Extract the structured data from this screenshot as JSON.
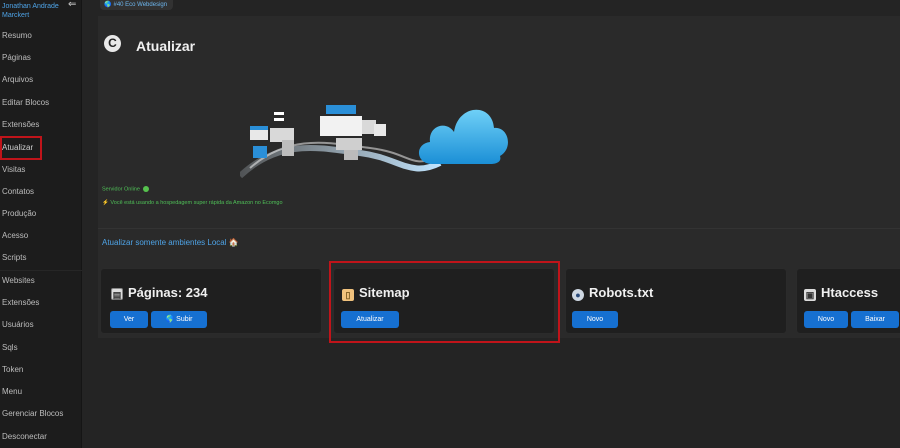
{
  "sidebar": {
    "user_name": "Jonathan Andrade Marckert",
    "items": [
      "Resumo",
      "Páginas",
      "Arquivos",
      "Editar Blocos",
      "Extensões",
      "Atualizar",
      "Visitas",
      "Contatos",
      "Produção",
      "Acesso",
      "Scripts",
      "Websites",
      "Extensões",
      "Usuários",
      "Sqls",
      "Token",
      "Menu",
      "Gerenciar Blocos",
      "Desconectar"
    ],
    "active_item": "Atualizar"
  },
  "header": {
    "badge": "#40 Eco Webdesign",
    "badge_icon": "globe-icon"
  },
  "hero": {
    "title": "Atualizar",
    "status": "Servidor Online",
    "notice": "Você está usando a hospedagem super rápida da Amazon no Ecomgo"
  },
  "local_link": "Atualizar somente ambientes Local 🏠",
  "cards": {
    "pages": {
      "title": "Páginas: 234",
      "ver": "Ver",
      "subir": "Subir"
    },
    "sitemap": {
      "title": "Sitemap",
      "atualizar": "Atualizar"
    },
    "robots": {
      "title": "Robots.txt",
      "novo": "Novo"
    },
    "htaccess": {
      "title": "Htaccess",
      "novo": "Novo",
      "baixar": "Baixar"
    }
  },
  "colors": {
    "accent": "#1670d1",
    "link": "#4ea3e6",
    "highlight": "#c0141a",
    "status": "#4fbf57"
  }
}
